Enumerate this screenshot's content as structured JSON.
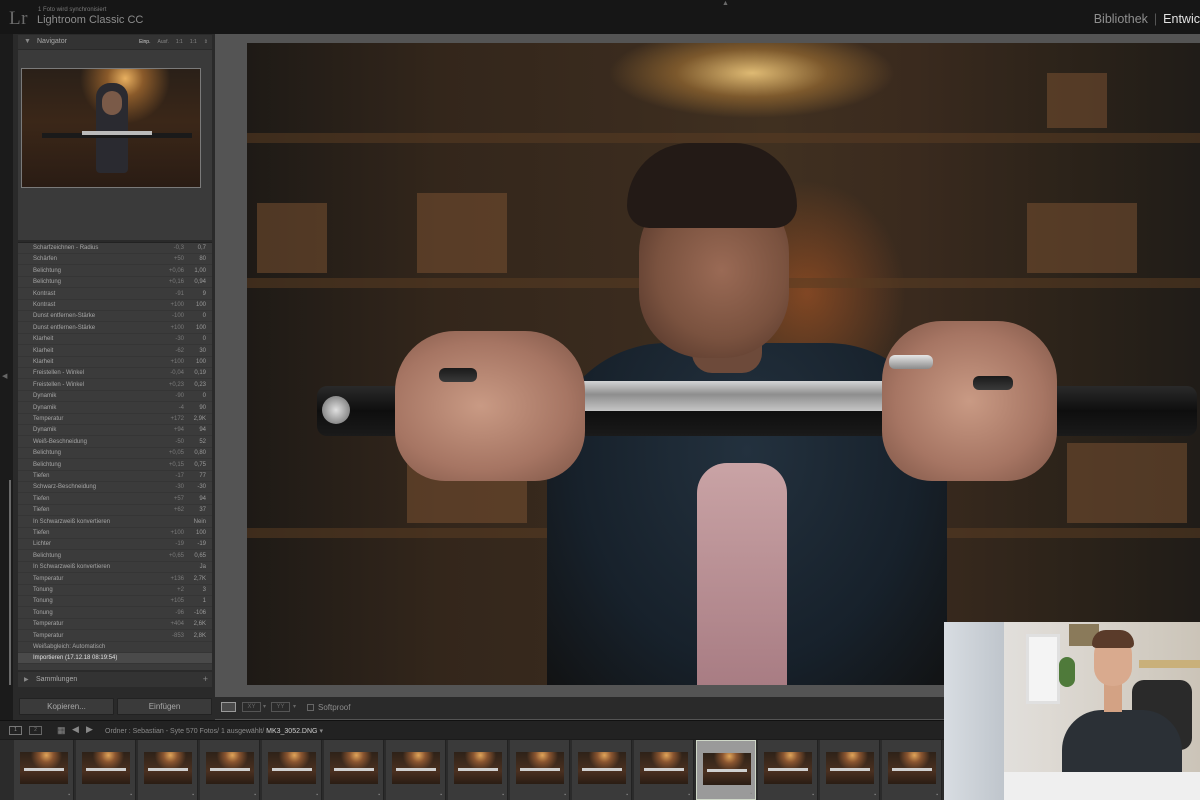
{
  "topbar": {
    "logo": "Lr",
    "sync_status": "1 Foto wird synchronisiert",
    "app_title": "Lightroom Classic CC",
    "modules": [
      "Bibliothek",
      "Entwic"
    ],
    "active_module": "Entwic",
    "separator": "|"
  },
  "navigator": {
    "title": "Navigator",
    "zoom_options": [
      "Einp.",
      "Ausf.",
      "1:1",
      "1:1",
      "⇕"
    ],
    "selected_zoom": "Einp."
  },
  "history": [
    {
      "name": "Scharfzeichnen - Radius",
      "delta": "-0,3",
      "value": "0,7"
    },
    {
      "name": "Schärfen",
      "delta": "+50",
      "value": "80"
    },
    {
      "name": "Belichtung",
      "delta": "+0,06",
      "value": "1,00"
    },
    {
      "name": "Belichtung",
      "delta": "+0,16",
      "value": "0,94"
    },
    {
      "name": "Kontrast",
      "delta": "-91",
      "value": "9"
    },
    {
      "name": "Kontrast",
      "delta": "+100",
      "value": "100"
    },
    {
      "name": "Dunst entfernen-Stärke",
      "delta": "-100",
      "value": "0"
    },
    {
      "name": "Dunst entfernen-Stärke",
      "delta": "+100",
      "value": "100"
    },
    {
      "name": "Klarheit",
      "delta": "-30",
      "value": "0"
    },
    {
      "name": "Klarheit",
      "delta": "-62",
      "value": "30"
    },
    {
      "name": "Klarheit",
      "delta": "+100",
      "value": "100"
    },
    {
      "name": "Freistellen - Winkel",
      "delta": "-0,04",
      "value": "0,19"
    },
    {
      "name": "Freistellen - Winkel",
      "delta": "+0,23",
      "value": "0,23"
    },
    {
      "name": "Dynamik",
      "delta": "-90",
      "value": "0"
    },
    {
      "name": "Dynamik",
      "delta": "-4",
      "value": "90"
    },
    {
      "name": "Temperatur",
      "delta": "+172",
      "value": "2,9K"
    },
    {
      "name": "Dynamik",
      "delta": "+94",
      "value": "94"
    },
    {
      "name": "Weiß-Beschneidung",
      "delta": "-50",
      "value": "52"
    },
    {
      "name": "Belichtung",
      "delta": "+0,05",
      "value": "0,80"
    },
    {
      "name": "Belichtung",
      "delta": "+0,15",
      "value": "0,75"
    },
    {
      "name": "Tiefen",
      "delta": "-17",
      "value": "77"
    },
    {
      "name": "Schwarz-Beschneidung",
      "delta": "-30",
      "value": "-30"
    },
    {
      "name": "Tiefen",
      "delta": "+57",
      "value": "94"
    },
    {
      "name": "Tiefen",
      "delta": "+62",
      "value": "37"
    },
    {
      "name": "In Schwarzweiß konvertieren",
      "delta": "",
      "value": "Nein"
    },
    {
      "name": "Tiefen",
      "delta": "+100",
      "value": "100"
    },
    {
      "name": "Lichter",
      "delta": "-19",
      "value": "-19"
    },
    {
      "name": "Belichtung",
      "delta": "+0,65",
      "value": "0,65"
    },
    {
      "name": "In Schwarzweiß konvertieren",
      "delta": "",
      "value": "Ja"
    },
    {
      "name": "Temperatur",
      "delta": "+136",
      "value": "2,7K"
    },
    {
      "name": "Tonung",
      "delta": "+2",
      "value": "3"
    },
    {
      "name": "Tonung",
      "delta": "+105",
      "value": "1"
    },
    {
      "name": "Tonung",
      "delta": "-96",
      "value": "-106"
    },
    {
      "name": "Temperatur",
      "delta": "+404",
      "value": "2,6K"
    },
    {
      "name": "Temperatur",
      "delta": "-853",
      "value": "2,8K"
    },
    {
      "name": "Weißabgleich: Automatisch",
      "delta": "",
      "value": ""
    },
    {
      "name": "Importieren (17.12.18 08:19:54)",
      "delta": "",
      "value": ""
    }
  ],
  "collections": {
    "title": "Sammlungen",
    "add": "+"
  },
  "buttons": {
    "copy": "Kopieren...",
    "paste": "Einfügen"
  },
  "toolbar": {
    "compare_label": "XY",
    "survey_label": "YY",
    "softproof": "Softproof"
  },
  "filmstrip": {
    "screen1": "1",
    "screen2": "2",
    "source_prefix": "Ordner : Sebastian - Syte",
    "photo_count": "570 Fotos/",
    "selection": "1 ausgewählt/",
    "filename": "MK3_3052.DNG",
    "frame_count": 20,
    "selected_index": 11
  },
  "colors": {
    "panel": "#2a2a2a",
    "center_bg": "#545454",
    "active_text": "#e2e2e2"
  }
}
